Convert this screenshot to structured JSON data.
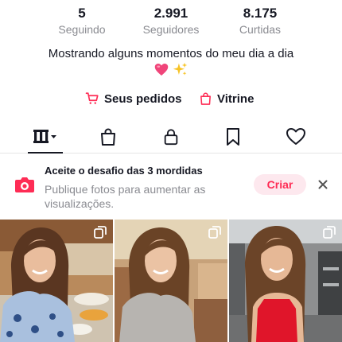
{
  "profile": {
    "stats": [
      {
        "value": "5",
        "label": "Seguindo"
      },
      {
        "value": "2.991",
        "label": "Seguidores"
      },
      {
        "value": "8.175",
        "label": "Curtidas"
      }
    ],
    "bio": "Mostrando alguns momentos do meu dia a dia",
    "bio_emojis": [
      "heart-emoji",
      "sparkles-emoji"
    ]
  },
  "links": {
    "orders_label": "Seus pedidos",
    "showcase_label": "Vitrine"
  },
  "tabs": [
    {
      "name": "videos-grid",
      "icon": "grid-icon",
      "active": true
    },
    {
      "name": "shop",
      "icon": "shopping-bag-icon",
      "active": false
    },
    {
      "name": "private",
      "icon": "lock-icon",
      "active": false
    },
    {
      "name": "saved",
      "icon": "bookmark-icon",
      "active": false
    },
    {
      "name": "liked",
      "icon": "heart-outline-icon",
      "active": false
    }
  ],
  "challenge": {
    "title": "Aceite o desafio das 3 mordidas",
    "description": "Publique fotos para aumentar as visualizações.",
    "button_label": "Criar",
    "icon": "camera-icon"
  },
  "grid": [
    {
      "scene": "kitchen-breakfast-selfie",
      "multi_photo": true
    },
    {
      "scene": "living-room-selfie",
      "multi_photo": true
    },
    {
      "scene": "gym-selfie-red-top",
      "multi_photo": true
    }
  ],
  "colors": {
    "accent": "#fe2c55",
    "text": "#161823",
    "secondary": "#8a8b91",
    "button_bg": "#fde8ee"
  }
}
